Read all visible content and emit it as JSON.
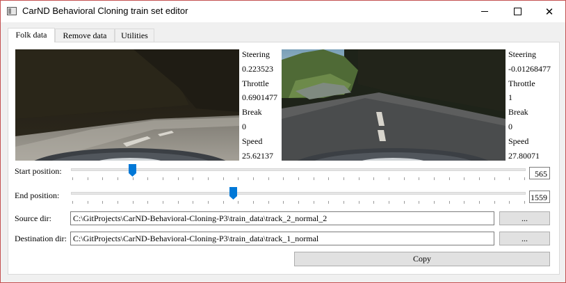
{
  "window": {
    "title": "CarND Behavioral Cloning train set editor"
  },
  "tabs": [
    {
      "label": "Folk data",
      "active": true
    },
    {
      "label": "Remove data",
      "active": false
    },
    {
      "label": "Utilities",
      "active": false
    }
  ],
  "left_camera": {
    "steering_label": "Steering",
    "steering": "0.223523",
    "throttle_label": "Throttle",
    "throttle": "0.6901477",
    "break_label": "Break",
    "break": "0",
    "speed_label": "Speed",
    "speed": "25.62137"
  },
  "right_camera": {
    "steering_label": "Steering",
    "steering": "-0.01268477",
    "throttle_label": "Throttle",
    "throttle": "1",
    "break_label": "Break",
    "break": "0",
    "speed_label": "Speed",
    "speed": "27.80071"
  },
  "start_position": {
    "label": "Start position:",
    "value": "565",
    "fraction": 0.135
  },
  "end_position": {
    "label": "End position:",
    "value": "1559",
    "fraction": 0.357
  },
  "source_dir": {
    "label": "Source dir:",
    "value": "C:\\GitProjects\\CarND-Behavioral-Cloning-P3\\train_data\\track_2_normal_2",
    "browse_label": "..."
  },
  "destination_dir": {
    "label": "Destination dir:",
    "value": "C:\\GitProjects\\CarND-Behavioral-Cloning-P3\\train_data\\track_1_normal",
    "browse_label": "..."
  },
  "copy_label": "Copy",
  "colors": {
    "accent": "#0078d7",
    "window_border": "#c45050"
  }
}
